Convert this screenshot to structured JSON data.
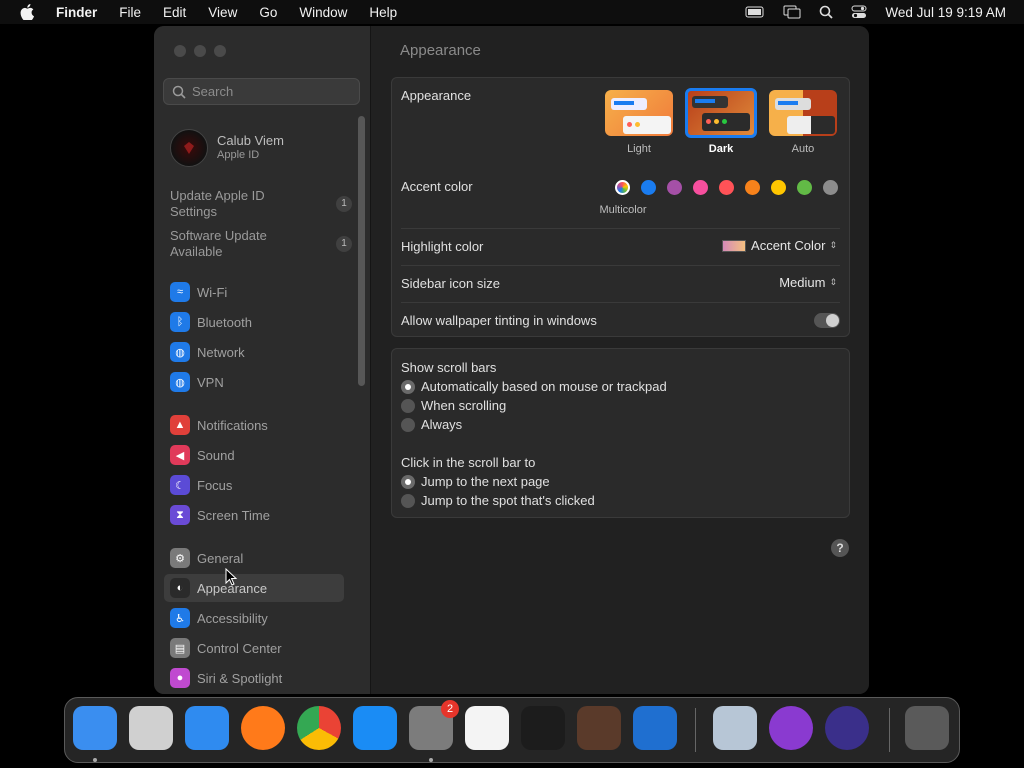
{
  "menubar": {
    "app": "Finder",
    "items": [
      "File",
      "Edit",
      "View",
      "Go",
      "Window",
      "Help"
    ],
    "clock": "Wed Jul 19  9:19 AM"
  },
  "sidebar": {
    "search_placeholder": "Search",
    "account": {
      "name": "Calub Viem",
      "subtitle": "Apple ID"
    },
    "updates": [
      {
        "label": "Update Apple ID Settings",
        "count": "1"
      },
      {
        "label": "Software Update Available",
        "count": "1"
      }
    ],
    "items": [
      {
        "label": "Wi-Fi",
        "icon": "wifi-icon",
        "color": "#1f7ae8"
      },
      {
        "label": "Bluetooth",
        "icon": "bluetooth-icon",
        "color": "#1f7ae8"
      },
      {
        "label": "Network",
        "icon": "globe-icon",
        "color": "#1f7ae8"
      },
      {
        "label": "VPN",
        "icon": "vpn-globe-icon",
        "color": "#1f7ae8"
      },
      {
        "label": "Notifications",
        "icon": "bell-icon",
        "color": "#e0403a"
      },
      {
        "label": "Sound",
        "icon": "speaker-icon",
        "color": "#e03a5a"
      },
      {
        "label": "Focus",
        "icon": "moon-icon",
        "color": "#5b4bd6"
      },
      {
        "label": "Screen Time",
        "icon": "hourglass-icon",
        "color": "#6a4bd6"
      },
      {
        "label": "General",
        "icon": "gear-icon",
        "color": "#7a7a7a"
      },
      {
        "label": "Appearance",
        "icon": "appearance-icon",
        "color": "#2a2a2a"
      },
      {
        "label": "Accessibility",
        "icon": "accessibility-icon",
        "color": "#1f7ae8"
      },
      {
        "label": "Control Center",
        "icon": "control-center-icon",
        "color": "#7a7a7a"
      },
      {
        "label": "Siri & Spotlight",
        "icon": "siri-icon",
        "color": "#c04ad0"
      }
    ],
    "selected": "Appearance"
  },
  "content": {
    "title": "Appearance",
    "appearance_label": "Appearance",
    "modes": [
      "Light",
      "Dark",
      "Auto"
    ],
    "selected_mode": "Dark",
    "accent_label": "Accent color",
    "accent_colors": [
      "#ffffff",
      "#1a7cf0",
      "#a550a7",
      "#f74f9e",
      "#ff5257",
      "#f7821b",
      "#ffc600",
      "#62ba46",
      "#8c8c8c"
    ],
    "accent_selected_name": "Multicolor",
    "highlight_label": "Highlight color",
    "highlight_value": "Accent Color",
    "icon_size_label": "Sidebar icon size",
    "icon_size_value": "Medium",
    "tinting_label": "Allow wallpaper tinting in windows",
    "tinting_enabled": false,
    "scroll_bars_label": "Show scroll bars",
    "scroll_options": [
      "Automatically based on mouse or trackpad",
      "When scrolling",
      "Always"
    ],
    "scroll_selected": 0,
    "click_label": "Click in the scroll bar to",
    "click_options": [
      "Jump to the next page",
      "Jump to the spot that's clicked"
    ],
    "click_selected": 0,
    "help": "?"
  },
  "dock": {
    "apps": [
      "Finder",
      "Launchpad",
      "Safari",
      "Firefox",
      "Chrome",
      "App Store",
      "System Settings",
      "TextEdit",
      "Terminal",
      "GarageBand",
      "Visual Studio Code",
      "Preview",
      "Podcasts",
      "Proxyman",
      "Trash"
    ],
    "system_settings_badge": "2"
  }
}
